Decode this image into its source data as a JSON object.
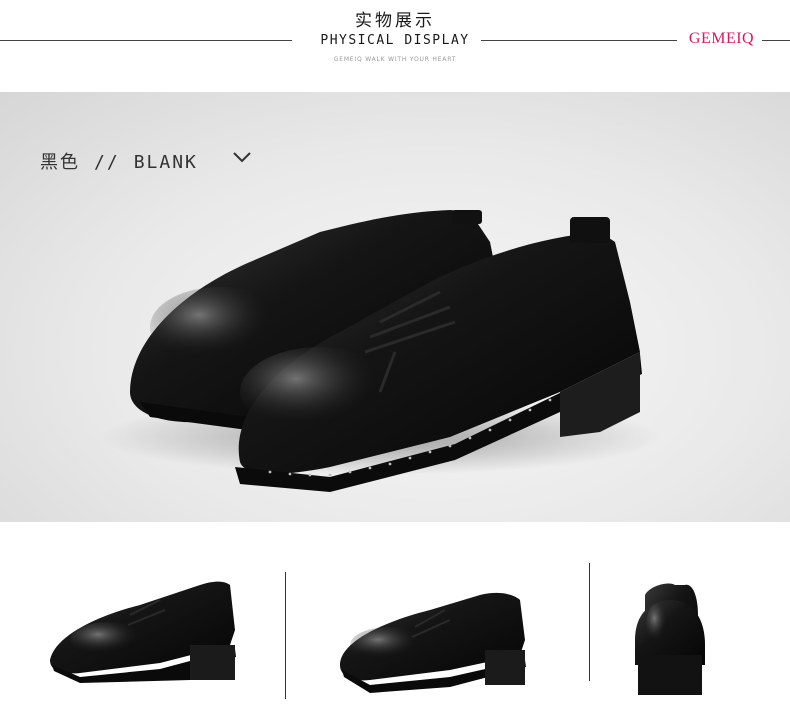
{
  "header": {
    "title_cn": "实物展示",
    "title_en": "PHYSICAL DISPLAY",
    "tagline": "GEMEIQ WALK WITH YOUR HEART",
    "brand": "GEMEIQ",
    "brand_color": "#d61a6b"
  },
  "hero": {
    "color_cn": "黑色",
    "separator": "//",
    "color_en": "BLANK",
    "chevron_icon": "chevron-down-icon"
  },
  "thumbnails": [
    {
      "view": "side view"
    },
    {
      "view": "front-angle view"
    },
    {
      "view": "back view"
    }
  ]
}
